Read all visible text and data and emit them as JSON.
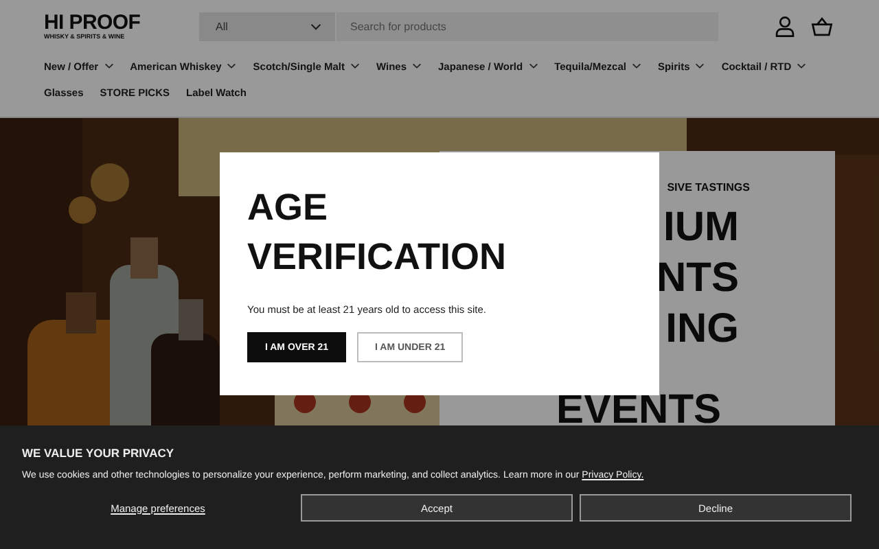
{
  "header": {
    "logo": {
      "name": "HI PROOF",
      "tagline": "WHISKY & SPIRITS & WINE"
    },
    "search": {
      "category": "All",
      "placeholder": "Search for products"
    }
  },
  "nav": [
    {
      "label": "New / Offer",
      "has_menu": true
    },
    {
      "label": "American Whiskey",
      "has_menu": true
    },
    {
      "label": "Scotch/Single Malt",
      "has_menu": true
    },
    {
      "label": "Wines",
      "has_menu": true
    },
    {
      "label": "Japanese / World",
      "has_menu": true
    },
    {
      "label": "Tequila/Mezcal",
      "has_menu": true
    },
    {
      "label": "Spirits",
      "has_menu": true
    },
    {
      "label": "Cocktail / RTD",
      "has_menu": true
    },
    {
      "label": "Glasses",
      "has_menu": false
    },
    {
      "label": "STORE PICKS",
      "has_menu": false
    },
    {
      "label": "Label Watch",
      "has_menu": false
    }
  ],
  "hero": {
    "kind": "picture",
    "panel": {
      "eyebrow": "SIVE TASTINGS",
      "lines": [
        "IUM",
        "NTS",
        "ING",
        "EVENTS"
      ]
    }
  },
  "age_modal": {
    "title": "AGE VERIFICATION",
    "message": "You must be at least 21 years old to access this site.",
    "buttons": [
      {
        "label": "I AM OVER 21",
        "primary": true
      },
      {
        "label": "I AM UNDER 21",
        "primary": false
      }
    ]
  },
  "cookie_banner": {
    "title": "WE VALUE YOUR PRIVACY",
    "text": "We use cookies and other technologies to personalize your experience, perform marketing, and collect analytics. Learn more in our",
    "link": "Privacy Policy.",
    "manage": "Manage preferences",
    "buttons": [
      "Accept",
      "Decline"
    ]
  }
}
